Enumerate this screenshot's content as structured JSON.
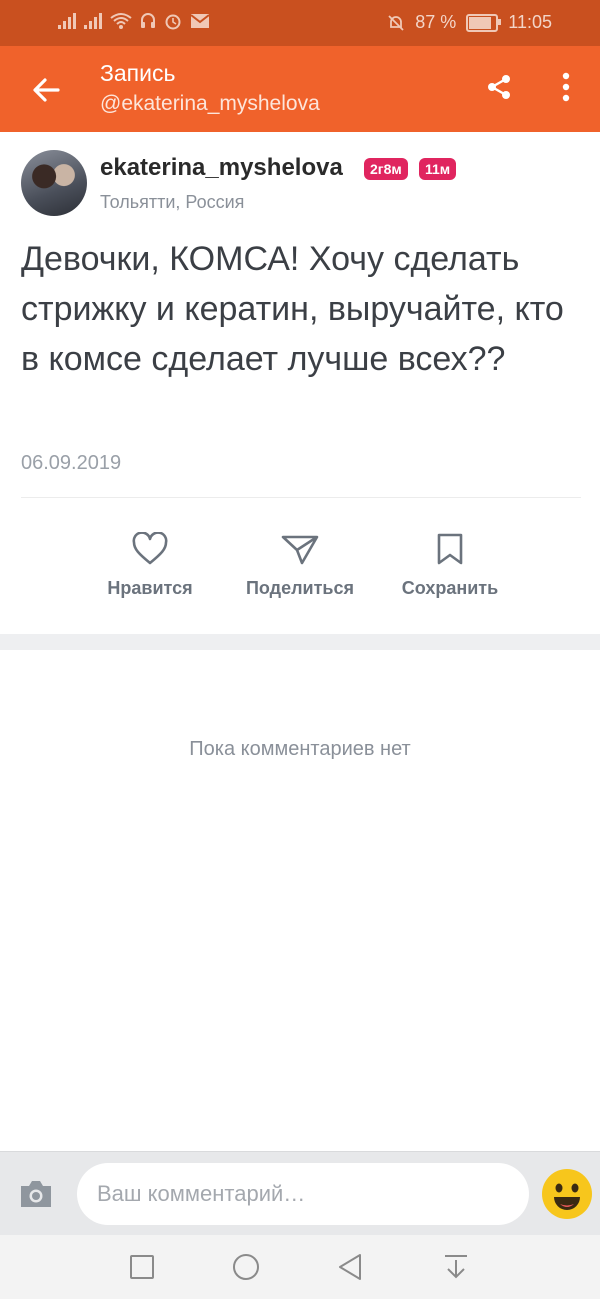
{
  "status_bar": {
    "battery": "87 %",
    "battery_level": 0.87,
    "time": "11:05"
  },
  "app_bar": {
    "title": "Запись",
    "subtitle": "@ekaterina_myshelova",
    "icons": [
      "arrow-left-icon",
      "share-icon",
      "more-vert-icon"
    ]
  },
  "post": {
    "username": "ekaterina_myshelova",
    "badges": [
      "2г8м",
      "11м"
    ],
    "location": "Тольятти, Россия",
    "text": "Девочки, КОМСА! Хочу сделать стрижку и кератин, выручайте, кто в комсе сделает лучше всех??",
    "date": "06.09.2019"
  },
  "actions": [
    {
      "label": "Нравится",
      "icon": "heart-icon"
    },
    {
      "label": "Поделиться",
      "icon": "send-icon"
    },
    {
      "label": "Сохранить",
      "icon": "bookmark-icon"
    }
  ],
  "comments": {
    "empty_text": "Пока комментариев нет"
  },
  "comment_bar": {
    "placeholder": "Ваш комментарий…",
    "icons": [
      "camera-icon",
      "emoji-icon"
    ]
  },
  "colors": {
    "status_bar": "#c9501f",
    "app_bar": "#f0622b",
    "badge": "#e0255f"
  }
}
